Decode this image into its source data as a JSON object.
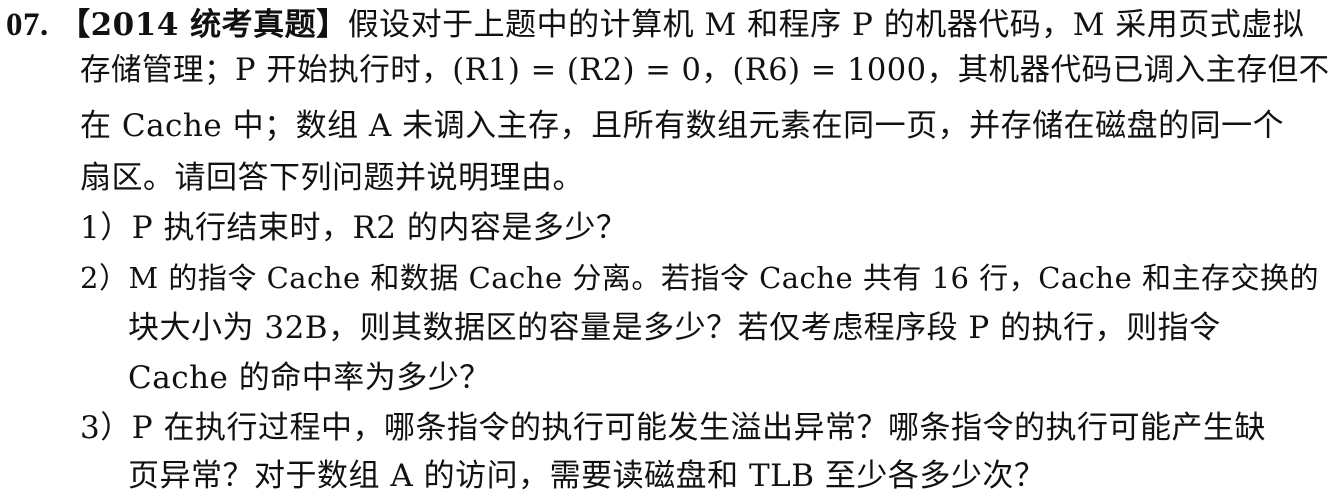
{
  "question": {
    "number": "07.",
    "source": "【2014 统考真题】",
    "stem_lines": [
      "假设对于上题中的计算机 M 和程序 P 的机器代码，M 采用页式虚拟",
      "存储管理；P 开始执行时，(R1) = (R2) = 0，(R6) = 1000，其机器代码已调入主存但不",
      "在 Cache 中；数组 A 未调入主存，且所有数组元素在同一页，并存储在磁盘的同一个",
      "扇区。请回答下列问题并说明理由。"
    ],
    "sub_questions": [
      {
        "label": "1）",
        "lines": [
          "P 执行结束时，R2 的内容是多少？"
        ]
      },
      {
        "label": "2）",
        "lines": [
          "M 的指令 Cache 和数据 Cache 分离。若指令 Cache 共有 16 行，Cache 和主存交换的",
          "块大小为 32B，则其数据区的容量是多少？若仅考虑程序段 P 的执行，则指令",
          "Cache 的命中率为多少？"
        ]
      },
      {
        "label": "3）",
        "lines": [
          "P 在执行过程中，哪条指令的执行可能发生溢出异常？哪条指令的执行可能产生缺",
          "页异常？对于数组 A 的访问，需要读磁盘和 TLB 至少各多少次？"
        ]
      }
    ]
  }
}
